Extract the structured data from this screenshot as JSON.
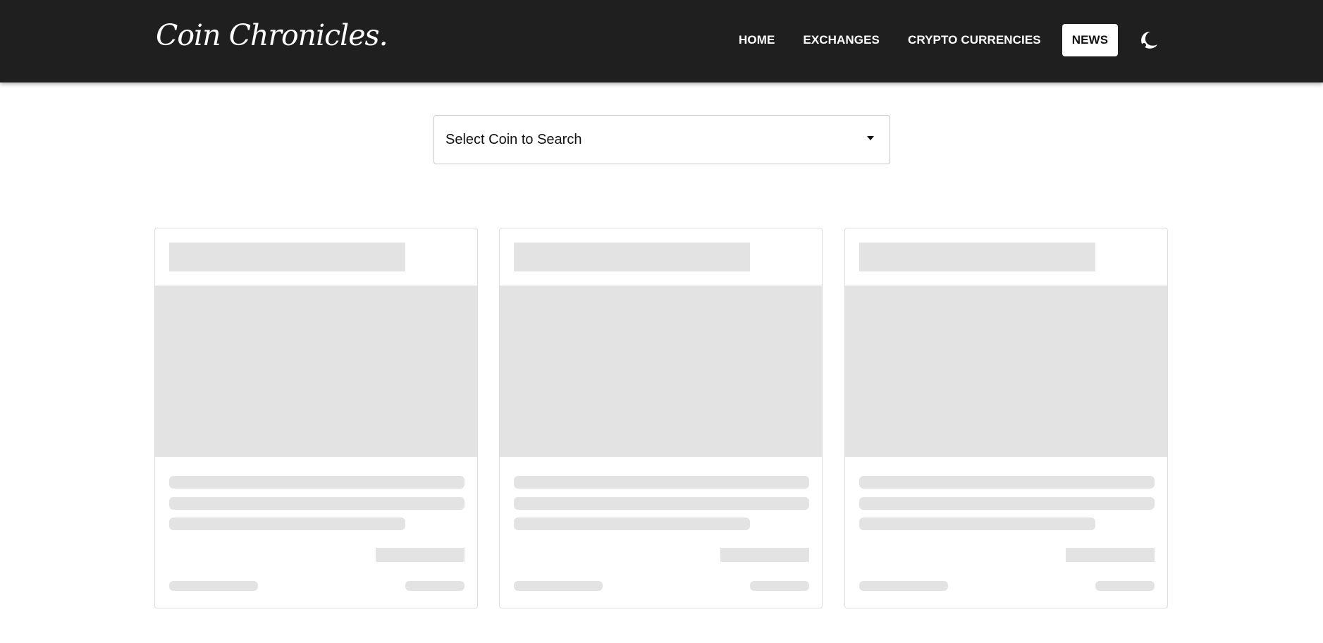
{
  "header": {
    "logo": "Coin Chronicles.",
    "nav": [
      {
        "label": "HOME",
        "active": false
      },
      {
        "label": "EXCHANGES",
        "active": false
      },
      {
        "label": "CRYPTO CURRENCIES",
        "active": false
      },
      {
        "label": "NEWS",
        "active": true
      }
    ],
    "theme_toggle_icon": "moon-icon"
  },
  "search": {
    "placeholder": "Select Coin to Search",
    "icon": "caret-down-icon"
  },
  "cards": [
    {
      "state": "loading-skeleton"
    },
    {
      "state": "loading-skeleton"
    },
    {
      "state": "loading-skeleton"
    }
  ],
  "colors": {
    "header_bg": "#1f1f1f",
    "skeleton": "#e3e3e3",
    "active_nav_bg": "#ffffff"
  }
}
